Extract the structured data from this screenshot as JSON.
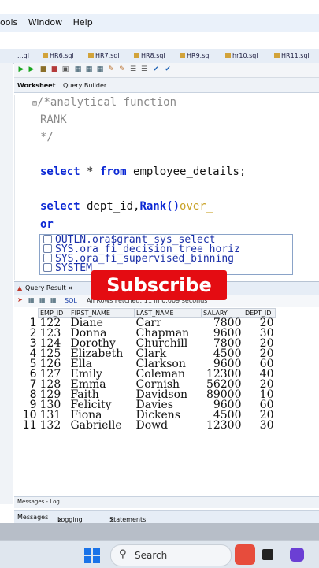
{
  "menu": [
    "ools",
    "Window",
    "Help"
  ],
  "file_tabs": [
    "...ql",
    "HR6.sql",
    "HR7.sql",
    "HR8.sql",
    "HR9.sql",
    "hr10.sql",
    "HR11.sql"
  ],
  "sub_tabs": {
    "worksheet": "Worksheet",
    "query_builder": "Query Builder"
  },
  "editor": {
    "lines": [
      "/*analytical function",
      "RANK",
      "*/",
      "select * from employee_details;",
      "select dept_id,Rank()over_",
      "or"
    ],
    "kw_select": "select",
    "kw_from": "from",
    "star": " * ",
    "table": " employee_details;",
    "dept": " dept_id,",
    "rank": "Rank()",
    "over": "over_",
    "typed": "or"
  },
  "autocomplete": [
    "OUTLN.ora$grant_sys_select",
    "SYS.ora_fi_decision_tree_horiz",
    "SYS.ora_fi_supervised_binning",
    "SYSTEM"
  ],
  "overlay": {
    "subscribe": "Subscribe"
  },
  "query_result": {
    "tab_label": "Query Result",
    "sql_label": "SQL",
    "fetched": "All Rows Fetched: 11 in 0.009 seconds"
  },
  "table": {
    "columns": [
      "EMP_ID",
      "FIRST_NAME",
      "LAST_NAME",
      "SALARY",
      "DEPT_ID"
    ],
    "rows": [
      [
        "1",
        "122",
        "Diane",
        "Carr",
        "7800",
        "20"
      ],
      [
        "2",
        "123",
        "Donna",
        "Chapman",
        "9600",
        "30"
      ],
      [
        "3",
        "124",
        "Dorothy",
        "Churchill",
        "7800",
        "20"
      ],
      [
        "4",
        "125",
        "Elizabeth",
        "Clark",
        "4500",
        "20"
      ],
      [
        "5",
        "126",
        "Ella",
        "Clarkson",
        "9600",
        "60"
      ],
      [
        "6",
        "127",
        "Emily",
        "Coleman",
        "12300",
        "40"
      ],
      [
        "7",
        "128",
        "Emma",
        "Cornish",
        "56200",
        "20"
      ],
      [
        "8",
        "129",
        "Faith",
        "Davidson",
        "89000",
        "10"
      ],
      [
        "9",
        "130",
        "Felicity",
        "Davies",
        "9600",
        "60"
      ],
      [
        "10",
        "131",
        "Fiona",
        "Dickens",
        "4500",
        "20"
      ],
      [
        "11",
        "132",
        "Gabrielle",
        "Dowd",
        "12300",
        "30"
      ]
    ]
  },
  "messages": {
    "title": "Messages - Log"
  },
  "bottom_tabs": [
    "Messages",
    "Logging Page",
    "Statements"
  ],
  "taskbar": {
    "search": "Search"
  }
}
